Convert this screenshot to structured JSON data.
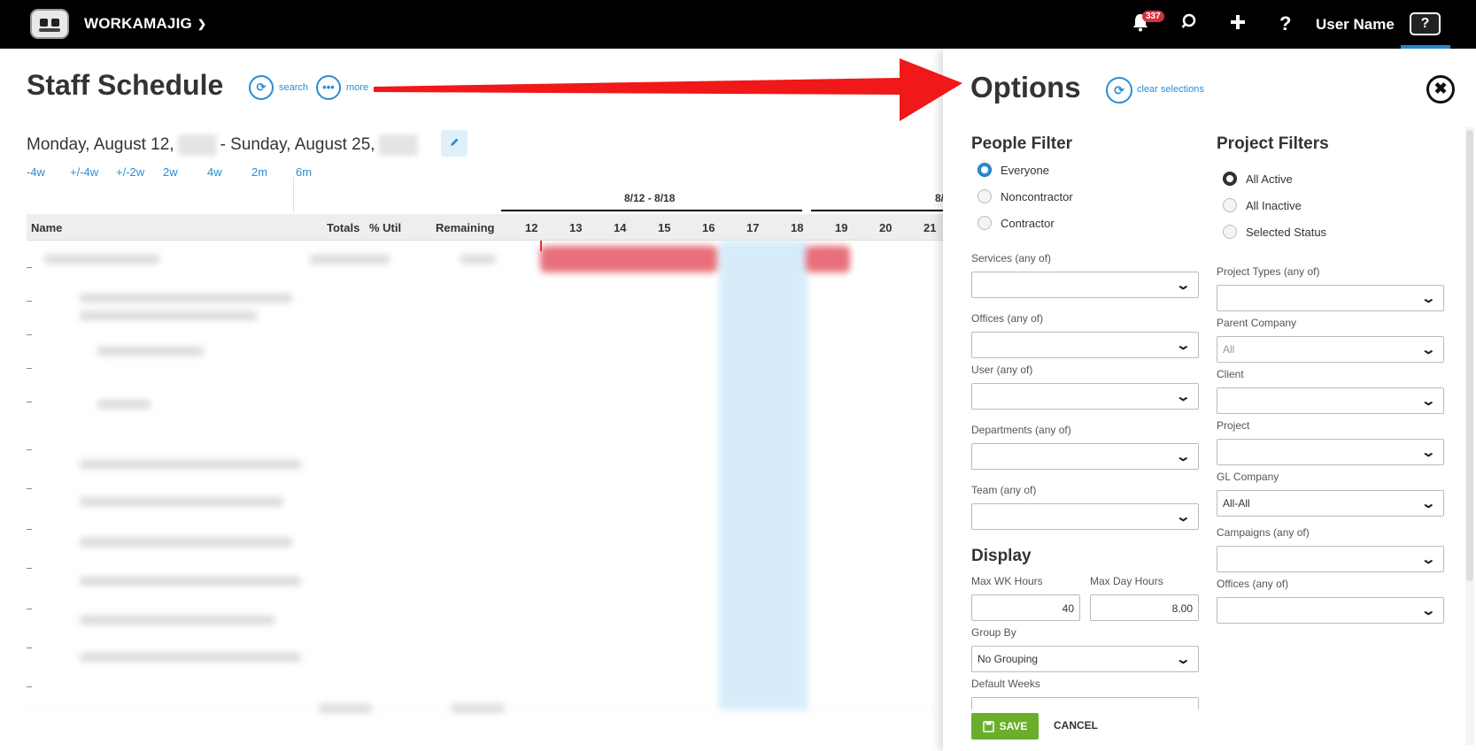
{
  "topbar": {
    "app_name": "WORKAMAJIG",
    "notification_count": "337",
    "username": "User Name",
    "help_label": "?"
  },
  "schedule": {
    "title": "Staff Schedule",
    "search_label": "search",
    "more_label": "more",
    "date_start": "Monday, August 12,",
    "date_end": "- Sunday, August 25,",
    "range_links": [
      "-4w",
      "+/-4w",
      "+/-2w",
      "2w",
      "4w",
      "2m",
      "6m"
    ],
    "week_labels": [
      "8/12 - 8/18",
      "8/"
    ],
    "columns": {
      "name": "Name",
      "totals": "Totals",
      "util": "% Util",
      "remaining": "Remaining",
      "days": [
        "12",
        "13",
        "14",
        "15",
        "16",
        "17",
        "18",
        "19",
        "20",
        "21"
      ]
    }
  },
  "options": {
    "title": "Options",
    "clear_label": "clear selections",
    "people_filter": {
      "title": "People Filter",
      "radios": [
        "Everyone",
        "Noncontractor",
        "Contractor"
      ],
      "selected": "Everyone",
      "services_label": "Services (any of)",
      "offices_label": "Offices (any of)",
      "user_label": "User (any of)",
      "departments_label": "Departments (any of)",
      "team_label": "Team (any of)"
    },
    "display": {
      "title": "Display",
      "max_wk_label": "Max WK Hours",
      "max_wk_value": "40",
      "max_day_label": "Max Day Hours",
      "max_day_value": "8.00",
      "group_by_label": "Group By",
      "group_by_value": "No Grouping",
      "default_weeks_label": "Default Weeks"
    },
    "project_filters": {
      "title": "Project Filters",
      "radios": [
        "All Active",
        "All Inactive",
        "Selected Status"
      ],
      "selected": "All Active",
      "project_types_label": "Project Types (any of)",
      "parent_company_label": "Parent Company",
      "parent_company_value": "All",
      "client_label": "Client",
      "project_label": "Project",
      "gl_company_label": "GL Company",
      "gl_company_value": "All-All",
      "campaigns_label": "Campaigns (any of)",
      "offices_label": "Offices (any of)"
    },
    "save_label": "SAVE",
    "cancel_label": "CANCEL"
  },
  "colors": {
    "accent": "#2a8dd4",
    "save": "#6aae2b",
    "badge": "#d9303e",
    "arrow": "#f01818"
  }
}
